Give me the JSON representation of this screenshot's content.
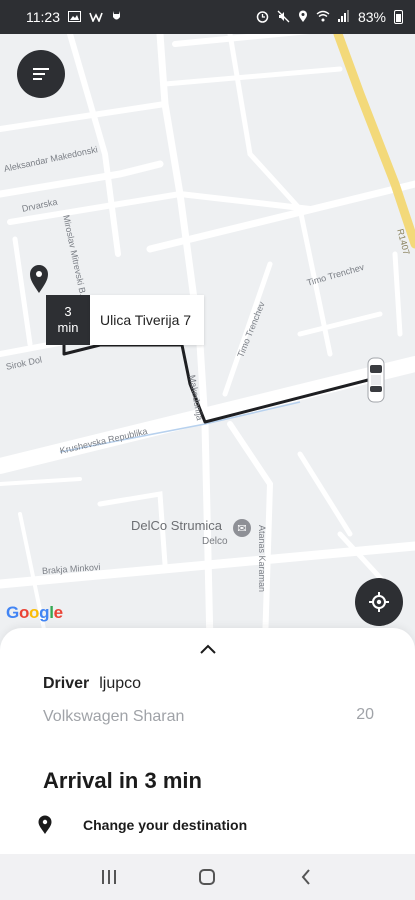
{
  "status_bar": {
    "time": "11:23",
    "battery": "83%",
    "left_icons": [
      "image-icon",
      "w-app-icon",
      "cat-app-icon"
    ],
    "right_icons": [
      "alarm-icon",
      "mute-icon",
      "location-icon",
      "wifi-icon",
      "signal-icon",
      "battery-icon"
    ]
  },
  "map": {
    "street_labels": {
      "makedonski": "Aleksandar Makedonski",
      "drvarska": "Drvarska",
      "mitrevski": "Miroslav Mitrevski B.",
      "timo1": "Timo Trenchev",
      "timo2": "Timo Trenchev",
      "sirok": "Sirok Dol",
      "krushevska": "Krushevska Republika",
      "makedonija": "Makedonija",
      "brakja": "Brakja Minkovi",
      "atanas": "Atanas Karaman",
      "r1407": "R1407"
    },
    "eta": {
      "value": "3",
      "unit": "min"
    },
    "address": "Ulica Tiverija 7",
    "poi": {
      "name": "DelCo Strumica",
      "sub": "Delco",
      "icon": "mail-icon"
    },
    "attribution": "Google",
    "colors": {
      "route": "#1e1f22",
      "highway": "#f3d97a",
      "road": "#ffffff",
      "dark_button": "#2d2f33"
    }
  },
  "sheet": {
    "driver_label": "Driver",
    "driver_name": "ljupco",
    "car_model": "Volkswagen Sharan",
    "plate": "20",
    "arrival": "Arrival in 3 min",
    "change_destination": "Change your destination"
  },
  "nav": {
    "recents": "recents-icon",
    "home": "home-icon",
    "back": "back-icon"
  }
}
